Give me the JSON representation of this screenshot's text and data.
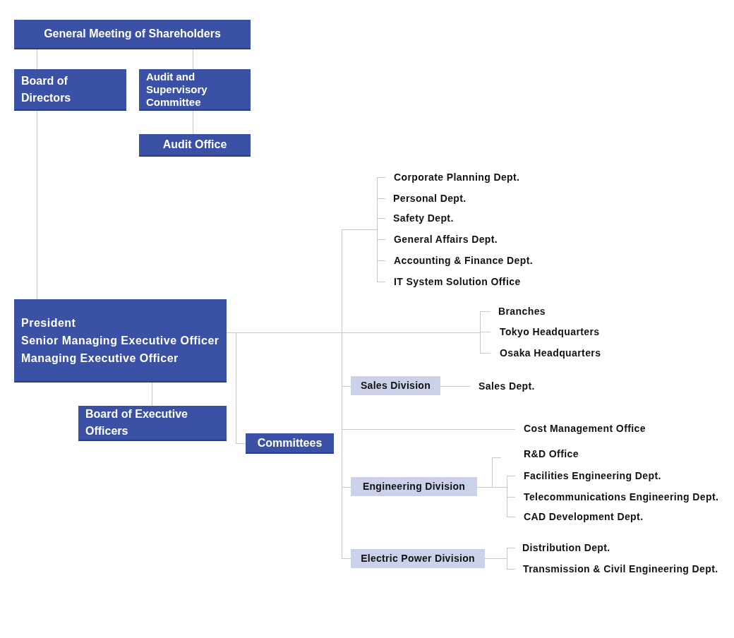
{
  "org_chart": {
    "nodes": [
      {
        "kind": "primary",
        "lines": [
          "General Meeting of Shareholders"
        ]
      },
      {
        "kind": "primary",
        "lines": [
          "Board of Directors"
        ]
      },
      {
        "kind": "primary",
        "lines": [
          "Audit and Supervisory Committee"
        ]
      },
      {
        "kind": "primary",
        "lines": [
          "Audit Office"
        ]
      },
      {
        "kind": "primary",
        "lines": [
          "President",
          "Senior Managing Executive Officer",
          "Managing Executive Officer"
        ]
      },
      {
        "kind": "primary",
        "lines": [
          "Board of Executive Officers"
        ]
      },
      {
        "kind": "primary",
        "lines": [
          "Committees"
        ]
      },
      {
        "kind": "division",
        "lines": [
          "Sales Division"
        ]
      },
      {
        "kind": "division",
        "lines": [
          "Engineering Division"
        ]
      },
      {
        "kind": "division",
        "lines": [
          "Electric Power Division"
        ]
      },
      {
        "kind": "unit",
        "lines": [
          "Corporate Planning Dept."
        ]
      },
      {
        "kind": "unit",
        "lines": [
          "Personal Dept."
        ]
      },
      {
        "kind": "unit",
        "lines": [
          "Safety Dept."
        ]
      },
      {
        "kind": "unit",
        "lines": [
          "General Affairs Dept."
        ]
      },
      {
        "kind": "unit",
        "lines": [
          "Accounting & Finance Dept."
        ]
      },
      {
        "kind": "unit",
        "lines": [
          "IT System Solution Office"
        ]
      },
      {
        "kind": "unit",
        "lines": [
          "Branches"
        ]
      },
      {
        "kind": "unit",
        "lines": [
          "Tokyo Headquarters"
        ]
      },
      {
        "kind": "unit",
        "lines": [
          "Osaka Headquarters"
        ]
      },
      {
        "kind": "unit",
        "lines": [
          "Sales Dept."
        ]
      },
      {
        "kind": "unit",
        "lines": [
          "Cost Management Office"
        ]
      },
      {
        "kind": "unit",
        "lines": [
          "R&D Office"
        ]
      },
      {
        "kind": "unit",
        "lines": [
          "Facilities Engineering Dept."
        ]
      },
      {
        "kind": "unit",
        "lines": [
          "Telecommunications Engineering Dept."
        ]
      },
      {
        "kind": "unit",
        "lines": [
          "CAD Development Dept."
        ]
      },
      {
        "kind": "unit",
        "lines": [
          "Distribution Dept."
        ]
      },
      {
        "kind": "unit",
        "lines": [
          "Transmission & Civil Engineering Dept."
        ]
      }
    ]
  }
}
